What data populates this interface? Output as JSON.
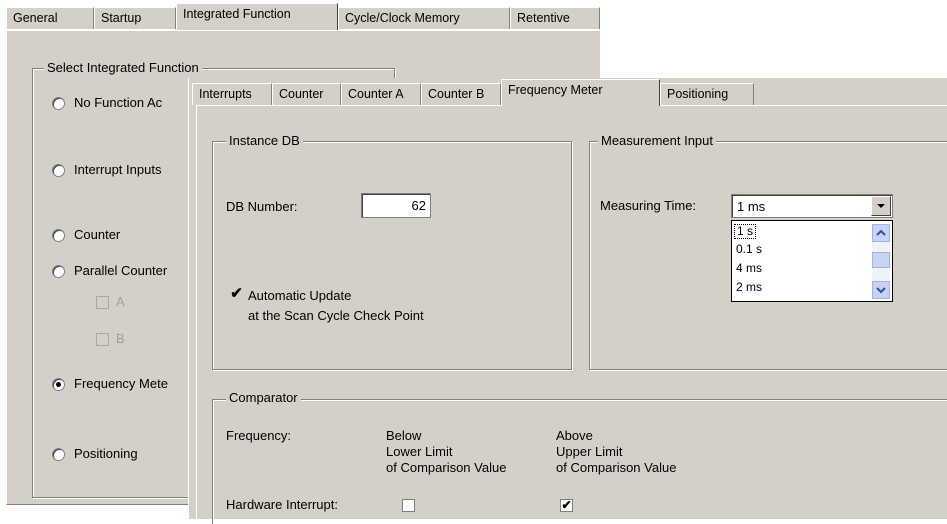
{
  "back_window": {
    "tabs": [
      "General",
      "Startup",
      "Integrated Function",
      "Cycle/Clock Memory",
      "Retentive"
    ],
    "group_title": "Select Integrated Function",
    "options": [
      {
        "label": "No Function Ac",
        "selected": false
      },
      {
        "label": "Interrupt Inputs",
        "selected": false
      },
      {
        "label": "Counter",
        "selected": false
      },
      {
        "label": "Parallel Counter",
        "selected": false
      },
      {
        "label": "Frequency Mete",
        "selected": true
      },
      {
        "label": "Positioning",
        "selected": false
      }
    ],
    "sub_checks": [
      "A",
      "B"
    ]
  },
  "front_window": {
    "tabs": [
      "Interrupts",
      "Counter",
      "Counter A",
      "Counter B",
      "Frequency Meter",
      "Positioning"
    ],
    "active_tab": "Frequency Meter",
    "instance_db": {
      "title": "Instance DB",
      "db_number_label": "DB Number:",
      "db_number_value": "62",
      "auto_update_line1": "Automatic Update",
      "auto_update_line2": "at the Scan Cycle Check Point",
      "auto_update_checked": true
    },
    "measurement_input": {
      "title": "Measurement Input",
      "measuring_time_label": "Measuring Time:",
      "selected_value": "1 ms",
      "list_items": [
        "1 s",
        "0.1 s",
        "4 ms",
        "2 ms"
      ]
    },
    "comparator": {
      "title": "Comparator",
      "frequency_label": "Frequency:",
      "below_col": [
        "Below",
        "Lower Limit",
        "of Comparison Value"
      ],
      "above_col": [
        "Above",
        "Upper Limit",
        "of Comparison Value"
      ],
      "hardware_interrupt_label": "Hardware Interrupt:",
      "below_checked": false,
      "above_checked": true
    }
  }
}
